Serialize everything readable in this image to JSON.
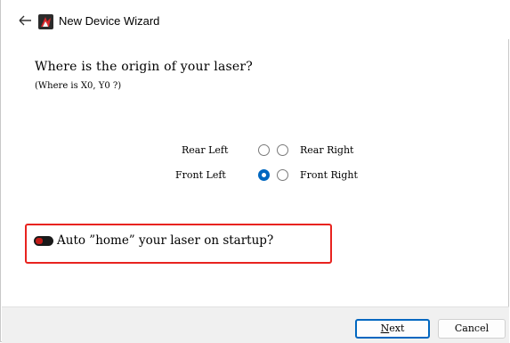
{
  "window": {
    "title": "New Device Wizard",
    "back_icon": "arrow-left-icon",
    "app_icon": "lightburn-logo-icon"
  },
  "main": {
    "question": "Where is the origin of your laser?",
    "hint": "(Where is X0, Y0 ?)",
    "options": {
      "rear_left": {
        "label": "Rear Left",
        "checked": false
      },
      "rear_right": {
        "label": "Rear Right",
        "checked": false
      },
      "front_left": {
        "label": "Front Left",
        "checked": true
      },
      "front_right": {
        "label": "Front Right",
        "checked": false
      }
    },
    "auto_home": {
      "label": "Auto ”home” your laser on startup?",
      "enabled": true
    },
    "highlight_color": "#e8231f"
  },
  "footer": {
    "next_label_first": "N",
    "next_label_rest": "ext",
    "cancel_label": "Cancel"
  },
  "colors": {
    "accent": "#0067c0",
    "toggle_on": "#c11b17"
  }
}
